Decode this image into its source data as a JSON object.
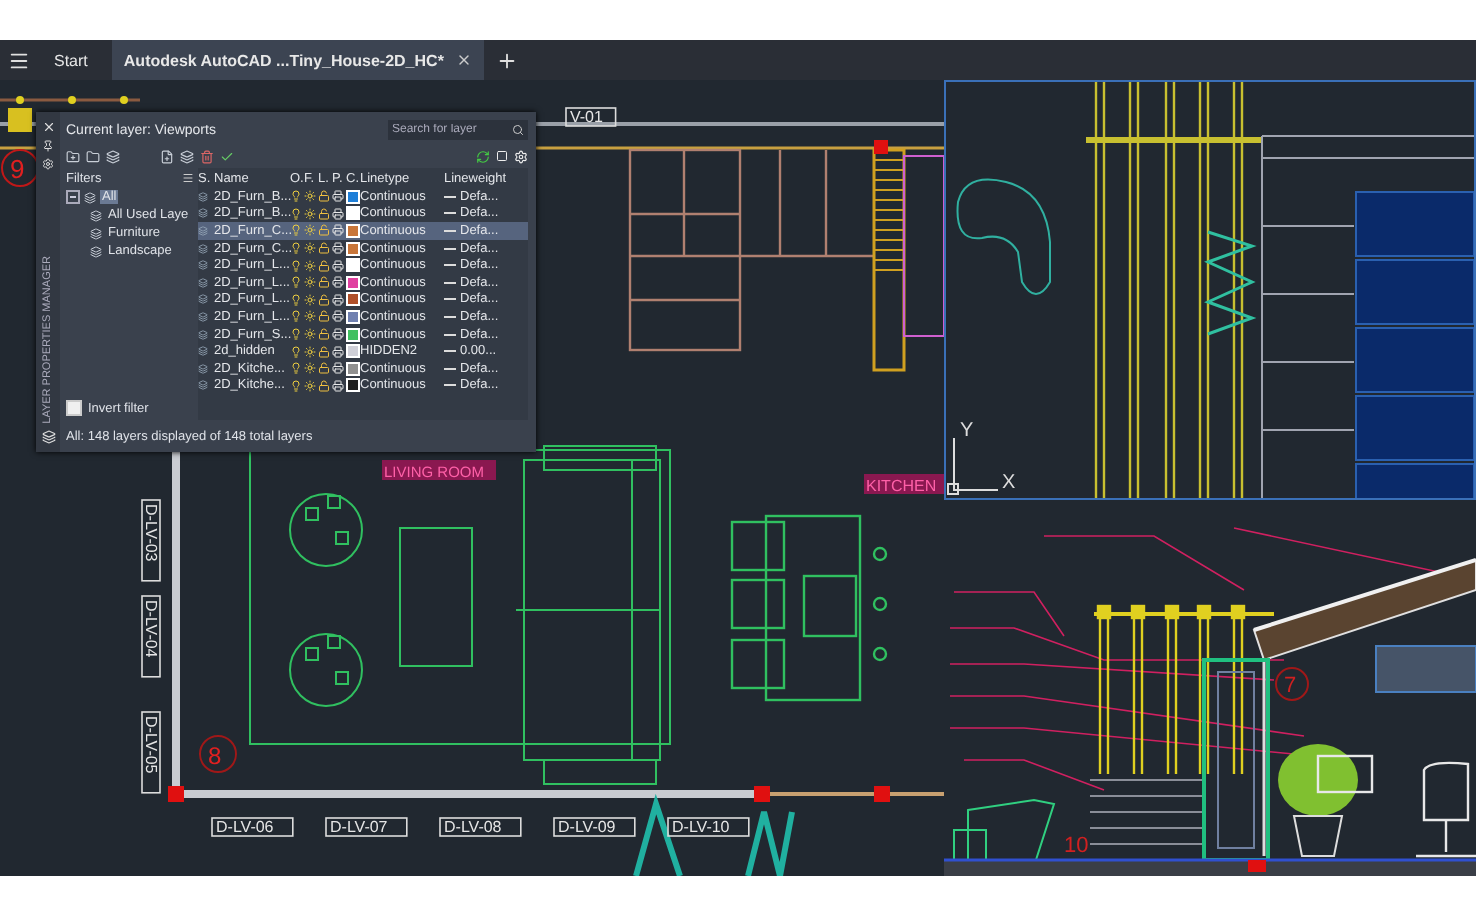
{
  "tabs": [
    {
      "label": "Start",
      "selected": false
    },
    {
      "label": "Autodesk AutoCAD ...Tiny_House-2D_HC*",
      "selected": true
    }
  ],
  "layer_panel": {
    "side_title": "LAYER PROPERTIES MANAGER",
    "title": "Current layer: Viewports",
    "search": {
      "placeholder": "Search for layer"
    },
    "filters": {
      "heading": "Filters",
      "tree": [
        {
          "label": "All",
          "selected": true,
          "expanded": true,
          "children": [
            {
              "label": "All Used Laye",
              "selected": false
            },
            {
              "label": "Furniture",
              "selected": false
            },
            {
              "label": "Landscape",
              "selected": false
            }
          ]
        }
      ],
      "invert_filter": {
        "label": "Invert filter",
        "checked": false
      }
    },
    "columns": [
      "S.",
      "Name",
      "O.",
      "F.",
      "L.",
      "P.",
      "C.",
      "Linetype",
      "Lineweight"
    ],
    "rows": [
      {
        "name": "2D_Furn_B...",
        "selected": false,
        "color": "#1e7fd8",
        "linetype": "Continuous",
        "lineweight": "Defa..."
      },
      {
        "name": "2D_Furn_B...",
        "selected": false,
        "color": "#ffffff",
        "linetype": "Continuous",
        "lineweight": "Defa..."
      },
      {
        "name": "2D_Furn_C...",
        "selected": true,
        "color": "#c8763a",
        "linetype": "Continuous",
        "lineweight": "Defa..."
      },
      {
        "name": "2D_Furn_C...",
        "selected": false,
        "color": "#c8763a",
        "linetype": "Continuous",
        "lineweight": "Defa..."
      },
      {
        "name": "2D_Furn_L...",
        "selected": false,
        "color": "#ffffff",
        "linetype": "Continuous",
        "lineweight": "Defa..."
      },
      {
        "name": "2D_Furn_L...",
        "selected": false,
        "color": "#e040a0",
        "linetype": "Continuous",
        "lineweight": "Defa..."
      },
      {
        "name": "2D_Furn_L...",
        "selected": false,
        "color": "#b0502a",
        "linetype": "Continuous",
        "lineweight": "Defa..."
      },
      {
        "name": "2D_Furn_L...",
        "selected": false,
        "color": "#7080b0",
        "linetype": "Continuous",
        "lineweight": "Defa..."
      },
      {
        "name": "2D_Furn_S...",
        "selected": false,
        "color": "#40c060",
        "linetype": "Continuous",
        "lineweight": "Defa..."
      },
      {
        "name": "2d_hidden",
        "selected": false,
        "color": "#d0d0d8",
        "linetype": "HIDDEN2",
        "lineweight": "0.00..."
      },
      {
        "name": "2D_Kitche...",
        "selected": false,
        "color": "#909090",
        "linetype": "Continuous",
        "lineweight": "Defa..."
      },
      {
        "name": "2D_Kitche...",
        "selected": false,
        "color": "#202020",
        "linetype": "Continuous",
        "lineweight": "Defa..."
      }
    ],
    "status": "All: 148 layers displayed of 148 total layers"
  },
  "floor_plan": {
    "tag_top": "V-01",
    "room_labels": [
      "LIVING ROOM",
      "KITCHEN"
    ],
    "elevation_tags_vertical": [
      "D-LV-03",
      "D-LV-04",
      "D-LV-05"
    ],
    "elevation_tags": [
      "D-LV-06",
      "D-LV-07",
      "D-LV-08",
      "D-LV-09",
      "D-LV-10"
    ],
    "markers": [
      "9",
      "8"
    ]
  },
  "section_view": {
    "markers": [
      "10",
      "7"
    ]
  },
  "ucs_icon": {
    "x_label": "X",
    "y_label": "Y"
  }
}
